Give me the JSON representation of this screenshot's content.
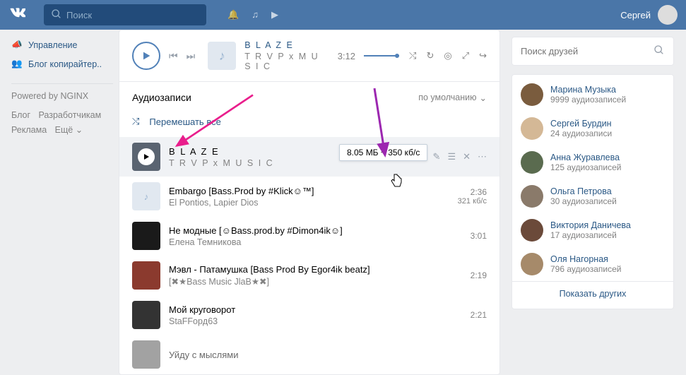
{
  "header": {
    "search_placeholder": "Поиск",
    "username": "Сергей"
  },
  "sidebar": {
    "nav1": "Управление",
    "nav2": "Блог копирайтер..",
    "powered": "Powered by NGINX",
    "link_blog": "Блог",
    "link_dev": "Разработчикам",
    "link_ads": "Реклама",
    "link_more": "Ещё"
  },
  "player": {
    "title": "B L A Z E",
    "artist": "T R V P x M U S I C",
    "time": "3:12"
  },
  "section": {
    "heading": "Аудиозаписи",
    "sort": "по умолчанию",
    "shuffle": "Перемешать все"
  },
  "tooltip": "8.05 МБ ~ 350 кб/с",
  "tracks": {
    "t0": {
      "title": "B L A Z E",
      "artist": "T R V P x M U S I C"
    },
    "t1": {
      "title": "Embargo [Bass.Prod by #Klick☺™]",
      "artist": "El Pontios, Lapier Dios",
      "dur": "2:36",
      "bitrate": "321 кб/с"
    },
    "t2": {
      "title": "Не модные [☺Bass.prod.by #Dimon4ik☺]",
      "artist": "Елена Темникова",
      "dur": "3:01"
    },
    "t3": {
      "title": "Мэвл - Патамушка [Bass Prod By Egor4ik beatz]",
      "artist": "[✖★Bass Music JlaB★✖]",
      "dur": "2:19"
    },
    "t4": {
      "title": "Мой круговорот",
      "artist": "StaFFopд63",
      "dur": "2:21"
    },
    "t5": {
      "title": "Уйду с мыслями"
    }
  },
  "right": {
    "search_placeholder": "Поиск друзей",
    "show_more": "Показать других",
    "friends": {
      "f0": {
        "name": "Марина Музыка",
        "sub": "9999 аудиозаписей"
      },
      "f1": {
        "name": "Сергей Бурдин",
        "sub": "24 аудиозаписи"
      },
      "f2": {
        "name": "Анна Журавлева",
        "sub": "125 аудиозаписей"
      },
      "f3": {
        "name": "Ольга Петрова",
        "sub": "30 аудиозаписей"
      },
      "f4": {
        "name": "Виктория Даничева",
        "sub": "17 аудиозаписей"
      },
      "f5": {
        "name": "Оля Нагорная",
        "sub": "796 аудиозаписей"
      }
    }
  }
}
